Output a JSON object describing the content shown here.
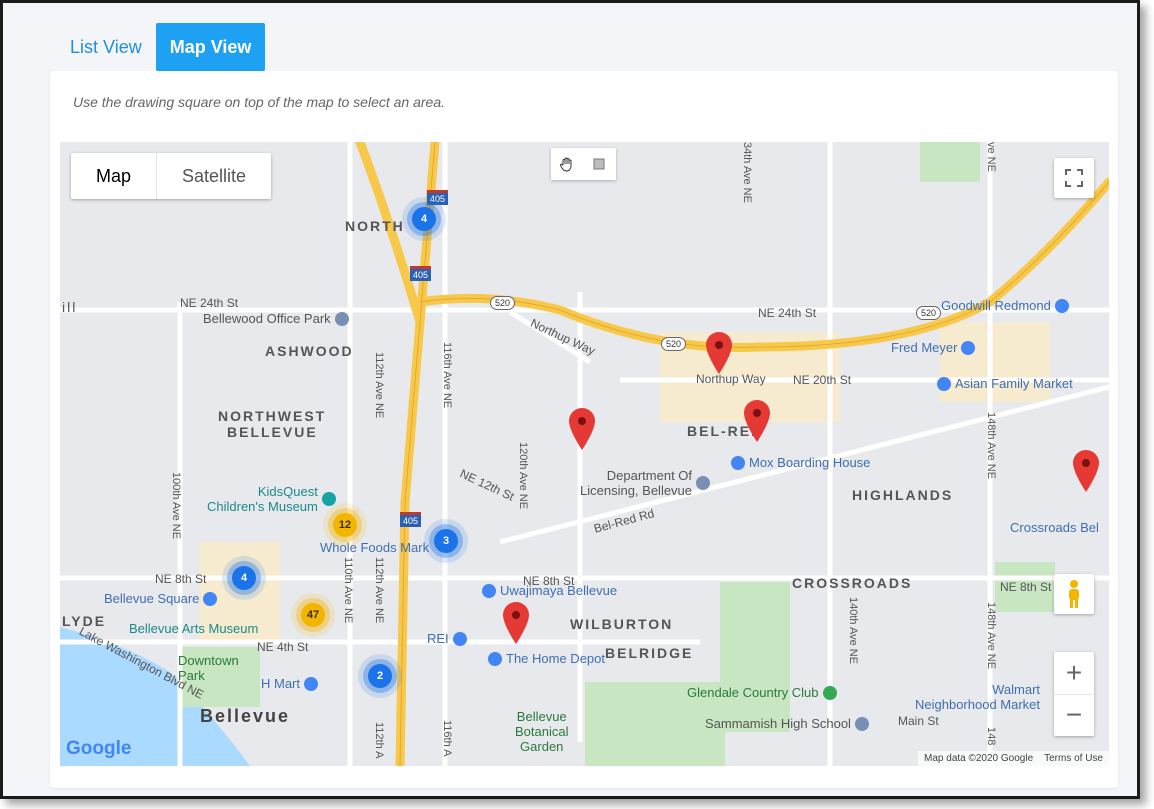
{
  "tabs": [
    {
      "label": "List View",
      "active": false
    },
    {
      "label": "Map View",
      "active": true
    }
  ],
  "hint": "Use the drawing square on top of the map to select an area.",
  "map": {
    "type_control": {
      "map": "Map",
      "satellite": "Satellite"
    },
    "draw_tools": [
      "hand-pan-icon",
      "square-draw-icon"
    ],
    "zoom": {
      "in": "+",
      "out": "−"
    },
    "attribution": {
      "data": "Map data ©2020 Google",
      "terms": "Terms of Use"
    },
    "logo": "Google",
    "neighborhoods": {
      "north": "NORTH",
      "ashwood": "ASHWOOD",
      "northwest": "NORTHWEST",
      "bellevue_nw": "BELLEVUE",
      "belred": "BEL-RED",
      "highlands": "HIGHLANDS",
      "crossroads": "CROSSROADS",
      "wilburton": "WILBURTON",
      "belridge": "BELRIDGE",
      "bellevue": "Bellevue",
      "lyde": "LYDE",
      "ill": "ill"
    },
    "streets": {
      "ne24_w": "NE 24th St",
      "ne24_e": "NE 24th St",
      "northup1": "Northup Way",
      "northup2": "Northup Way",
      "ne20": "NE 20th St",
      "ne12": "NE 12th St",
      "belred_rd": "Bel-Red Rd",
      "ne8_w": "NE 8th St",
      "ne8_m": "NE 8th St",
      "ne8_e": "NE 8th St",
      "ne4": "NE 4th St",
      "lake_wash": "Lake Washington Blvd NE",
      "main": "Main St",
      "ave100": "100th Ave NE",
      "ave110": "110th Ave NE",
      "ave112a": "112th Ave NE",
      "ave112b": "112th Ave NE",
      "ave112c": "112th A",
      "ave116a": "116th Ave NE",
      "ave116b": "116th A",
      "ave120": "120th Ave NE",
      "ave134": "34th Ave NE",
      "ave140": "140th Ave NE",
      "ave148a": "148th Ave NE",
      "ave148b": "148th Ave NE",
      "ave148c": "148",
      "avene_top": "ve NE"
    },
    "shields": {
      "i405a": "405",
      "i405b": "405",
      "i405c": "405",
      "sr520a": "520",
      "sr520b": "520",
      "sr520c": "520"
    },
    "pois": {
      "bellewood": "Bellewood Office Park",
      "goodwill": "Goodwill Redmond",
      "fredmeyer": "Fred Meyer",
      "asian": "Asian Family Market",
      "mox": "Mox Boarding House",
      "dol": "Department Of\nLicensing, Bellevue",
      "kidsquest": "KidsQuest\nChildren's Museum",
      "wholefoods": "Whole Foods Mark",
      "uwajimaya": "Uwajimaya Bellevue",
      "bellevuesq": "Bellevue Square",
      "artsmuseum": "Bellevue Arts Museum",
      "rei": "REI",
      "homedepot": "The Home Depot",
      "hmart": "H Mart",
      "downtownpark": "Downtown\nPark",
      "glendale": "Glendale Country Club",
      "sammamish": "Sammamish High School",
      "botanical": "Bellevue\nBotanical\nGarden",
      "walmart": "Walmart\nNeighborhood Market",
      "crossroadsbel": "Crossroads Bel"
    },
    "clusters": [
      {
        "count": "4",
        "color": "blue"
      },
      {
        "count": "12",
        "color": "yellow"
      },
      {
        "count": "3",
        "color": "blue"
      },
      {
        "count": "4",
        "color": "blue"
      },
      {
        "count": "47",
        "color": "yellow"
      },
      {
        "count": "2",
        "color": "blue"
      }
    ],
    "colors": {
      "marker": "#e53935",
      "cluster_blue": "#1a73e8",
      "cluster_yellow": "#f4b400",
      "highway": "#f8c84a",
      "park": "#c7e6c1",
      "water": "#aadaff"
    }
  }
}
